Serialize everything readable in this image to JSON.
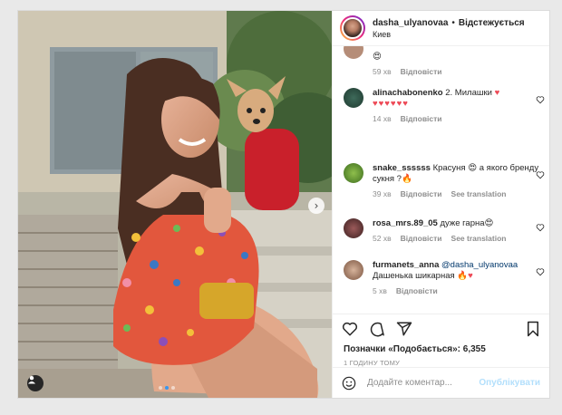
{
  "header": {
    "username": "dasha_ulyanovaa",
    "separator": "•",
    "follow_label": "Відстежується",
    "location": "Киев"
  },
  "comments": [
    {
      "user": "",
      "text": "",
      "time": "59 хв",
      "reply": "Відповісти",
      "translate": ""
    },
    {
      "user": "alinachabonenko",
      "text": "2. Милашки",
      "time": "14 хв",
      "reply": "Відповісти",
      "translate": ""
    },
    {
      "user": "snake_ssssss",
      "text": "Красуня",
      "text2": "а якого бренду сукня ?",
      "time": "39 хв",
      "reply": "Відповісти",
      "translate": "See translation"
    },
    {
      "user": "rosa_mrs.89_05",
      "text": "дуже гарна",
      "time": "52 хв",
      "reply": "Відповісти",
      "translate": "See translation"
    },
    {
      "user": "furmanets_anna",
      "mention": "@dasha_ulyanovaa",
      "text": "Дашенька шикарная",
      "time": "5 хв",
      "reply": "Відповісти",
      "translate": ""
    }
  ],
  "likes_text": "Позначки «Подобається»: 6,355",
  "time_ago": "1 годину тому",
  "add_comment_placeholder": "Додайте коментар...",
  "publish_label": "Опублікувати",
  "colors": {
    "link": "#00376b",
    "publish": "#b2dffc",
    "heart": "#ed4956",
    "muted": "#8e8e8e",
    "carousel_active": "#3897f0"
  },
  "icons": [
    "heart-icon",
    "comment-icon",
    "share-icon",
    "bookmark-icon",
    "emoji-icon",
    "tag-user-icon",
    "chevron-right-icon"
  ]
}
